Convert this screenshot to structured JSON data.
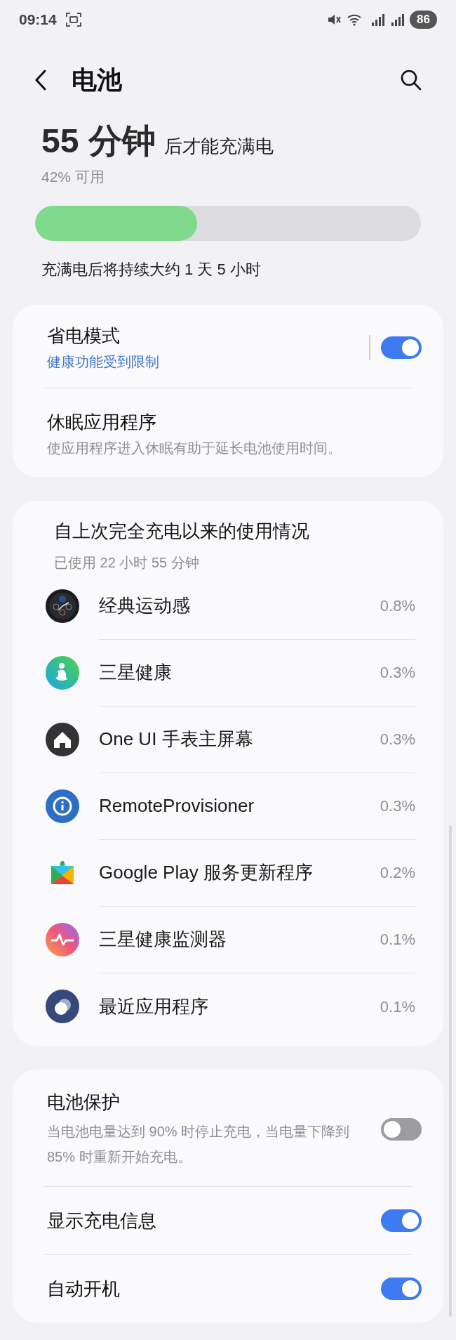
{
  "status_bar": {
    "time": "09:14",
    "battery": "86"
  },
  "header": {
    "title": "电池"
  },
  "charge": {
    "time": "55 分钟",
    "suffix": "后才能充满电",
    "available": "42% 可用",
    "level": 0.42,
    "estimate": "充满电后将持续大约 1 天 5 小时"
  },
  "power_card": [
    {
      "title": "省电模式",
      "subtitle": "健康功能受到限制",
      "kind": "switch",
      "on": true
    },
    {
      "title": "休眠应用程序",
      "subtitle": "使应用程序进入休眠有助于延长电池使用时间。",
      "kind": "plain"
    }
  ],
  "usage": {
    "title": "自上次完全充电以来的使用情况",
    "subtitle": "已使用 22 小时 55 分钟",
    "apps": [
      {
        "name": "经典运动感",
        "percent": "0.8%"
      },
      {
        "name": "三星健康",
        "percent": "0.3%"
      },
      {
        "name": "One UI 手表主屏幕",
        "percent": "0.3%"
      },
      {
        "name": "RemoteProvisioner",
        "percent": "0.3%"
      },
      {
        "name": "Google Play 服务更新程序",
        "percent": "0.2%"
      },
      {
        "name": "三星健康监测器",
        "percent": "0.1%"
      },
      {
        "name": "最近应用程序",
        "percent": "0.1%"
      }
    ]
  },
  "settings": [
    {
      "title": "电池保护",
      "subtitle": "当电池电量达到 90% 时停止充电，当电量下降到 85% 时重新开始充电。",
      "on": false
    },
    {
      "title": "显示充电信息",
      "on": true
    },
    {
      "title": "自动开机",
      "on": true
    }
  ]
}
